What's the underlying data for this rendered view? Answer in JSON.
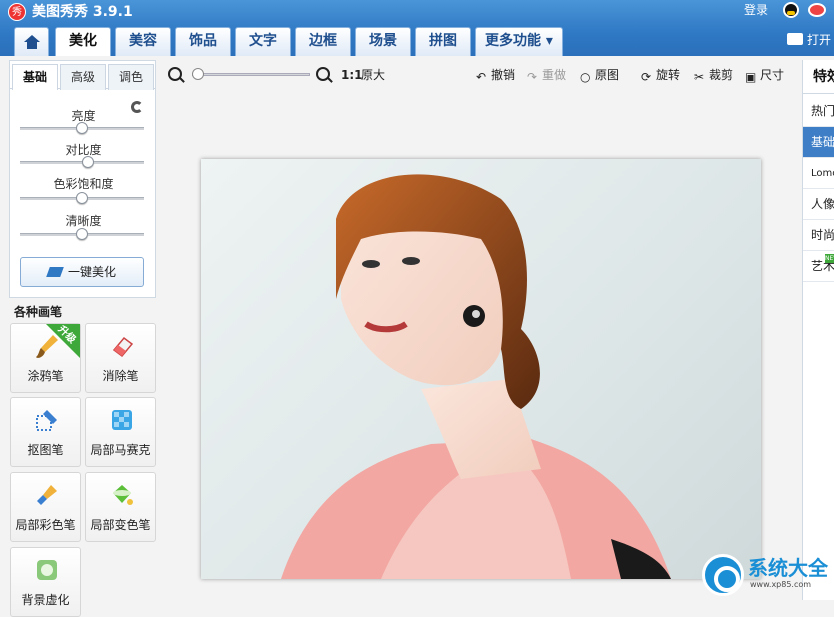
{
  "app": {
    "title": "美图秀秀 3.9.1",
    "logo_text": "秀",
    "login": "登录",
    "open": "打开"
  },
  "tabs": [
    {
      "label": ""
    },
    {
      "label": "美化"
    },
    {
      "label": "美容"
    },
    {
      "label": "饰品"
    },
    {
      "label": "文字"
    },
    {
      "label": "边框"
    },
    {
      "label": "场景"
    },
    {
      "label": "拼图"
    },
    {
      "label": "更多功能 ▾"
    }
  ],
  "panel": {
    "tabs": [
      {
        "label": "基础"
      },
      {
        "label": "高级"
      },
      {
        "label": "调色"
      }
    ],
    "sliders": [
      {
        "label": "亮度",
        "value": 0.5
      },
      {
        "label": "对比度",
        "value": 0.55
      },
      {
        "label": "色彩饱和度",
        "value": 0.5
      },
      {
        "label": "清晰度",
        "value": 0.5
      }
    ],
    "onekey": "一键美化"
  },
  "brushes": {
    "title": "各种画笔",
    "upgrade": "升级",
    "items": [
      {
        "label": "涂鸦笔"
      },
      {
        "label": "消除笔"
      },
      {
        "label": "抠图笔"
      },
      {
        "label": "局部马赛克"
      },
      {
        "label": "局部彩色笔"
      },
      {
        "label": "局部变色笔"
      },
      {
        "label": "背景虚化"
      }
    ]
  },
  "toolbar": {
    "ratio": "1:1",
    "original_size": "原大",
    "undo": "撤销",
    "redo": "重做",
    "original": "原图",
    "rotate": "旋转",
    "crop": "裁剪",
    "size": "尺寸",
    "zoom_level": 0.05
  },
  "effects": {
    "title": "特效",
    "items": [
      {
        "label": "热门"
      },
      {
        "label": "基础"
      },
      {
        "label": "Lomo"
      },
      {
        "label": "人像"
      },
      {
        "label": "时尚"
      },
      {
        "label": "艺术"
      }
    ],
    "new_badge": "NEW"
  },
  "watermark": {
    "name": "系统大全",
    "url": "www.xp85.com"
  },
  "colors": {
    "accent": "#2f78c4",
    "active_effect": "#3d7ec7",
    "upgrade_green": "#3ea93a"
  }
}
